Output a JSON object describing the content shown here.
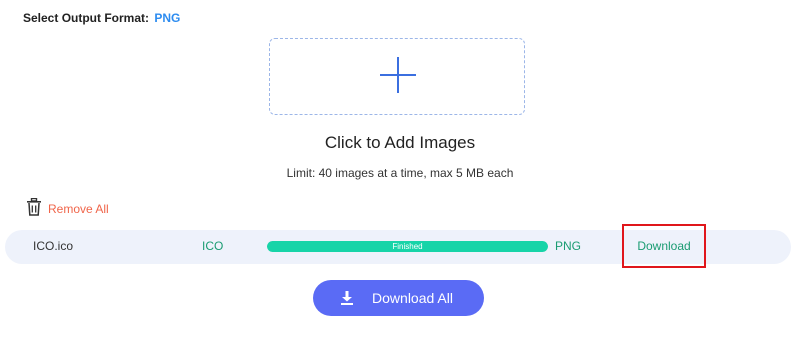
{
  "format": {
    "label": "Select Output Format:",
    "value": "PNG"
  },
  "upload": {
    "title": "Click to Add Images",
    "limit": "Limit: 40 images at a time, max 5 MB each"
  },
  "actions": {
    "remove_all": "Remove All",
    "download_all": "Download All"
  },
  "files": [
    {
      "name": "ICO.ico",
      "source_format": "ICO",
      "status": "Finished",
      "progress_percent": 100,
      "target_format": "PNG",
      "download_label": "Download"
    }
  ],
  "icons": {
    "add": "plus-icon",
    "remove": "trash-icon",
    "download_all": "download-icon"
  },
  "colors": {
    "accent_blue": "#2d8cf0",
    "remove_red": "#f0654a",
    "format_green": "#1a9c72",
    "progress_green": "#17d4a8",
    "primary_button": "#5a6bf5",
    "highlight_border": "#e0161b"
  }
}
